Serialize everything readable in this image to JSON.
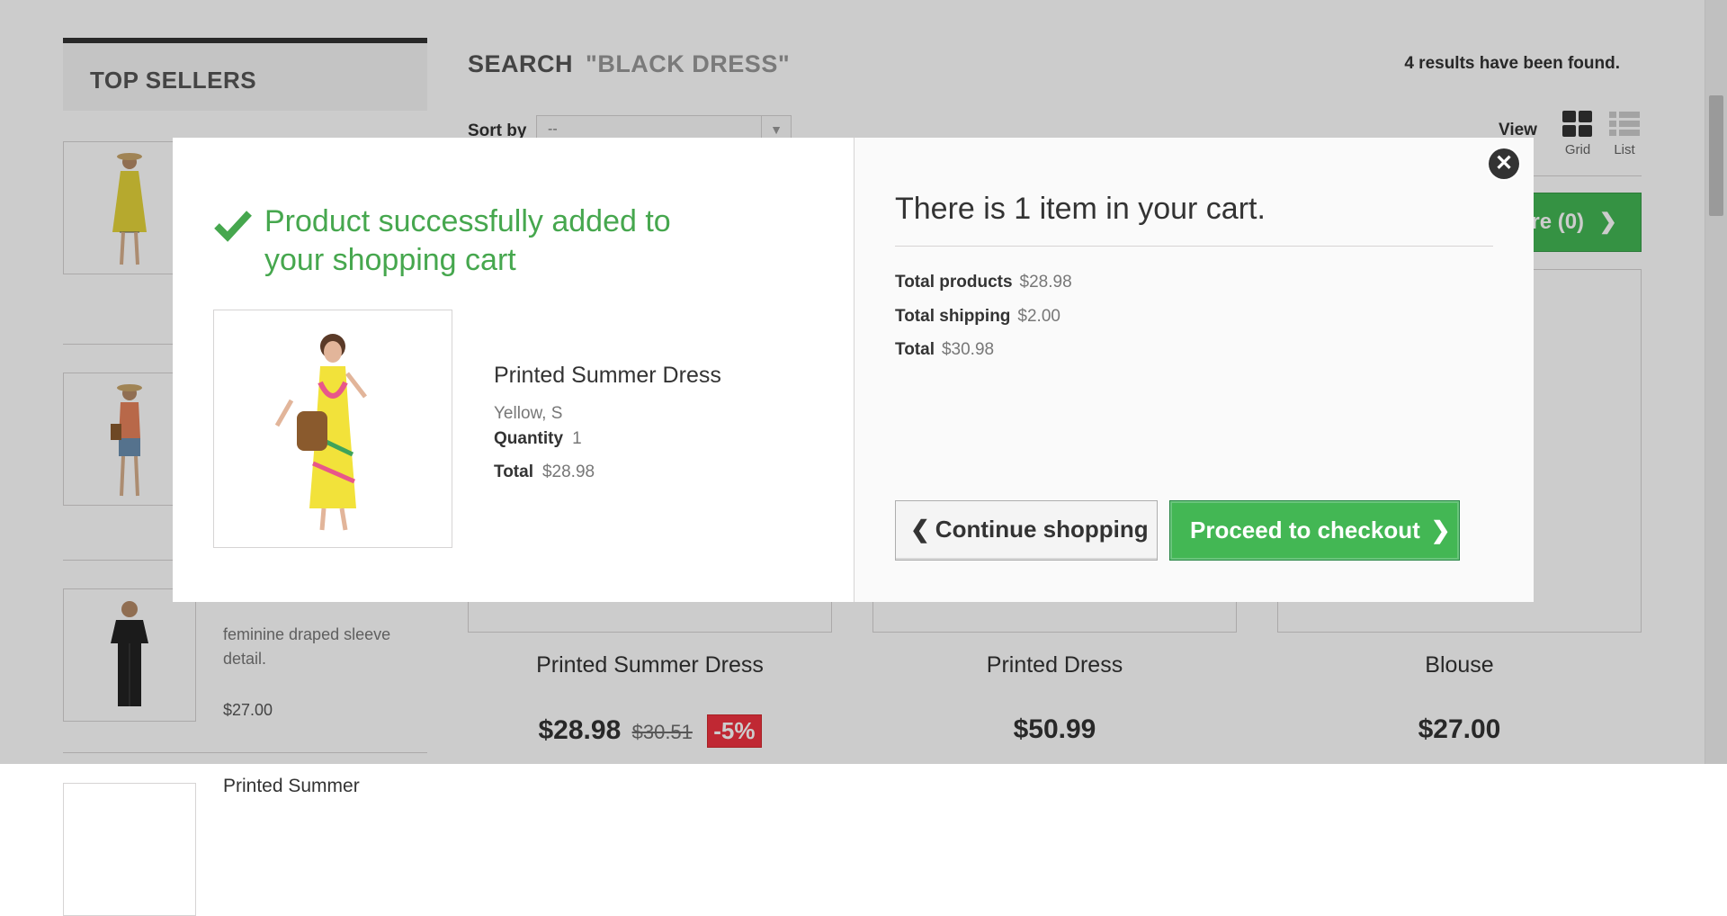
{
  "sidebar": {
    "title": "TOP SELLERS",
    "items": [
      {
        "desc": "",
        "price": ""
      },
      {
        "desc": "",
        "price": ""
      },
      {
        "desc": "feminine draped sleeve detail.",
        "price": "$27.00"
      },
      {
        "name": "Printed Summer"
      }
    ]
  },
  "search": {
    "label": "SEARCH",
    "query": "\"BLACK DRESS\"",
    "results_text": "4 results have been found."
  },
  "toolbar": {
    "sort_label": "Sort by",
    "sort_value": "--",
    "view_label": "View",
    "view_grid": "Grid",
    "view_list": "List",
    "compare_label": "are (0)"
  },
  "products": [
    {
      "name": "Printed Summer Dress",
      "price": "$28.98",
      "old_price": "$30.51",
      "discount": "-5%"
    },
    {
      "name": "Printed Dress",
      "price": "$50.99"
    },
    {
      "name": "Blouse",
      "price": "$27.00"
    }
  ],
  "modal": {
    "success_message": "Product successfully added to your shopping cart",
    "product_name": "Printed Summer Dress",
    "attributes": "Yellow, S",
    "quantity_label": "Quantity",
    "quantity_value": "1",
    "total_label": "Total",
    "total_value": "$28.98",
    "cart_title": "There is 1 item in your cart.",
    "total_products_label": "Total products",
    "total_products_value": "$28.98",
    "total_shipping_label": "Total shipping",
    "total_shipping_value": "$2.00",
    "cart_total_label": "Total",
    "cart_total_value": "$30.98",
    "continue_label": "Continue shopping",
    "checkout_label": "Proceed to checkout",
    "colors": {
      "success": "#46a74e",
      "button_green": "#43b754"
    }
  }
}
